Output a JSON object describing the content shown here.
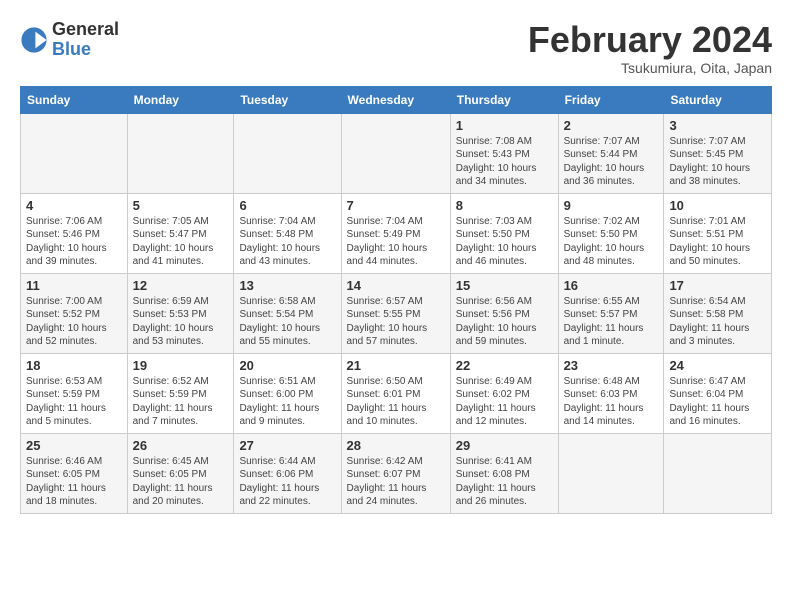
{
  "header": {
    "logo": {
      "general": "General",
      "blue": "Blue"
    },
    "title": "February 2024",
    "location": "Tsukumiura, Oita, Japan"
  },
  "calendar": {
    "weekdays": [
      "Sunday",
      "Monday",
      "Tuesday",
      "Wednesday",
      "Thursday",
      "Friday",
      "Saturday"
    ],
    "weeks": [
      [
        null,
        null,
        null,
        null,
        {
          "day": "1",
          "sunrise": "7:08 AM",
          "sunset": "5:43 PM",
          "daylight": "10 hours and 34 minutes."
        },
        {
          "day": "2",
          "sunrise": "7:07 AM",
          "sunset": "5:44 PM",
          "daylight": "10 hours and 36 minutes."
        },
        {
          "day": "3",
          "sunrise": "7:07 AM",
          "sunset": "5:45 PM",
          "daylight": "10 hours and 38 minutes."
        }
      ],
      [
        {
          "day": "4",
          "sunrise": "7:06 AM",
          "sunset": "5:46 PM",
          "daylight": "10 hours and 39 minutes."
        },
        {
          "day": "5",
          "sunrise": "7:05 AM",
          "sunset": "5:47 PM",
          "daylight": "10 hours and 41 minutes."
        },
        {
          "day": "6",
          "sunrise": "7:04 AM",
          "sunset": "5:48 PM",
          "daylight": "10 hours and 43 minutes."
        },
        {
          "day": "7",
          "sunrise": "7:04 AM",
          "sunset": "5:49 PM",
          "daylight": "10 hours and 44 minutes."
        },
        {
          "day": "8",
          "sunrise": "7:03 AM",
          "sunset": "5:50 PM",
          "daylight": "10 hours and 46 minutes."
        },
        {
          "day": "9",
          "sunrise": "7:02 AM",
          "sunset": "5:50 PM",
          "daylight": "10 hours and 48 minutes."
        },
        {
          "day": "10",
          "sunrise": "7:01 AM",
          "sunset": "5:51 PM",
          "daylight": "10 hours and 50 minutes."
        }
      ],
      [
        {
          "day": "11",
          "sunrise": "7:00 AM",
          "sunset": "5:52 PM",
          "daylight": "10 hours and 52 minutes."
        },
        {
          "day": "12",
          "sunrise": "6:59 AM",
          "sunset": "5:53 PM",
          "daylight": "10 hours and 53 minutes."
        },
        {
          "day": "13",
          "sunrise": "6:58 AM",
          "sunset": "5:54 PM",
          "daylight": "10 hours and 55 minutes."
        },
        {
          "day": "14",
          "sunrise": "6:57 AM",
          "sunset": "5:55 PM",
          "daylight": "10 hours and 57 minutes."
        },
        {
          "day": "15",
          "sunrise": "6:56 AM",
          "sunset": "5:56 PM",
          "daylight": "10 hours and 59 minutes."
        },
        {
          "day": "16",
          "sunrise": "6:55 AM",
          "sunset": "5:57 PM",
          "daylight": "11 hours and 1 minute."
        },
        {
          "day": "17",
          "sunrise": "6:54 AM",
          "sunset": "5:58 PM",
          "daylight": "11 hours and 3 minutes."
        }
      ],
      [
        {
          "day": "18",
          "sunrise": "6:53 AM",
          "sunset": "5:59 PM",
          "daylight": "11 hours and 5 minutes."
        },
        {
          "day": "19",
          "sunrise": "6:52 AM",
          "sunset": "5:59 PM",
          "daylight": "11 hours and 7 minutes."
        },
        {
          "day": "20",
          "sunrise": "6:51 AM",
          "sunset": "6:00 PM",
          "daylight": "11 hours and 9 minutes."
        },
        {
          "day": "21",
          "sunrise": "6:50 AM",
          "sunset": "6:01 PM",
          "daylight": "11 hours and 10 minutes."
        },
        {
          "day": "22",
          "sunrise": "6:49 AM",
          "sunset": "6:02 PM",
          "daylight": "11 hours and 12 minutes."
        },
        {
          "day": "23",
          "sunrise": "6:48 AM",
          "sunset": "6:03 PM",
          "daylight": "11 hours and 14 minutes."
        },
        {
          "day": "24",
          "sunrise": "6:47 AM",
          "sunset": "6:04 PM",
          "daylight": "11 hours and 16 minutes."
        }
      ],
      [
        {
          "day": "25",
          "sunrise": "6:46 AM",
          "sunset": "6:05 PM",
          "daylight": "11 hours and 18 minutes."
        },
        {
          "day": "26",
          "sunrise": "6:45 AM",
          "sunset": "6:05 PM",
          "daylight": "11 hours and 20 minutes."
        },
        {
          "day": "27",
          "sunrise": "6:44 AM",
          "sunset": "6:06 PM",
          "daylight": "11 hours and 22 minutes."
        },
        {
          "day": "28",
          "sunrise": "6:42 AM",
          "sunset": "6:07 PM",
          "daylight": "11 hours and 24 minutes."
        },
        {
          "day": "29",
          "sunrise": "6:41 AM",
          "sunset": "6:08 PM",
          "daylight": "11 hours and 26 minutes."
        },
        null,
        null
      ]
    ]
  }
}
